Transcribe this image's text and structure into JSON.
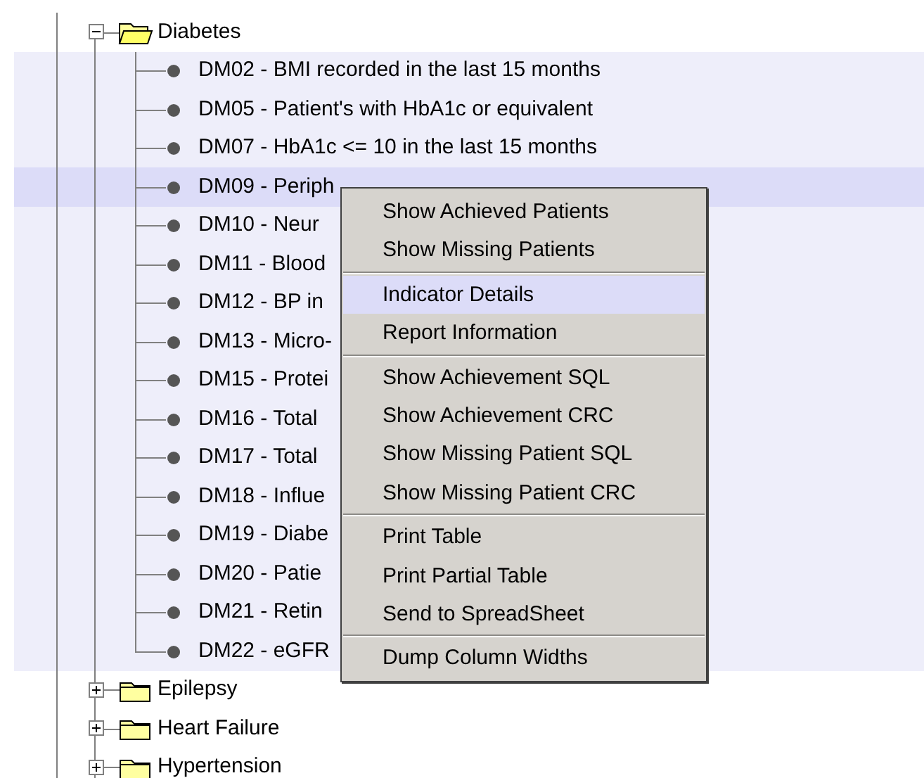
{
  "tree": [
    {
      "label": "Diabetes",
      "expanded": true,
      "children": [
        {
          "label": "DM02 - BMI recorded in the last 15 months",
          "selected": false
        },
        {
          "label": "DM05 - Patient's with HbA1c or equivalent",
          "selected": false
        },
        {
          "label": "DM07 - HbA1c <= 10 in the last 15 months",
          "selected": false
        },
        {
          "label": "DM09 - Periph",
          "selected": true
        },
        {
          "label": "DM10 - Neur",
          "selected": false
        },
        {
          "label": "DM11 - Blood",
          "selected": false
        },
        {
          "label": "DM12 - BP in",
          "selected": false
        },
        {
          "label": "DM13 - Micro-",
          "selected": false
        },
        {
          "label": "DM15 - Protei",
          "selected": false
        },
        {
          "label": "DM16 - Total",
          "selected": false
        },
        {
          "label": "DM17 - Total",
          "selected": false
        },
        {
          "label": "DM18 - Influe",
          "selected": false
        },
        {
          "label": "DM19 - Diabe",
          "selected": false
        },
        {
          "label": "DM20 - Patie",
          "selected": false
        },
        {
          "label": "DM21 - Retin",
          "selected": false
        },
        {
          "label": "DM22 - eGFR",
          "selected": false
        }
      ]
    },
    {
      "label": "Epilepsy",
      "expanded": false
    },
    {
      "label": "Heart Failure",
      "expanded": false
    },
    {
      "label": "Hypertension",
      "expanded": false
    }
  ],
  "context_menu": {
    "sections": [
      [
        {
          "label": "Show Achieved Patients",
          "selected": false
        },
        {
          "label": "Show Missing Patients",
          "selected": false
        }
      ],
      [
        {
          "label": "Indicator Details",
          "selected": true
        },
        {
          "label": "Report Information",
          "selected": false
        }
      ],
      [
        {
          "label": "Show Achievement SQL",
          "selected": false
        },
        {
          "label": "Show Achievement CRC",
          "selected": false
        },
        {
          "label": "Show Missing Patient SQL",
          "selected": false
        },
        {
          "label": "Show Missing Patient CRC",
          "selected": false
        }
      ],
      [
        {
          "label": "Print Table",
          "selected": false
        },
        {
          "label": "Print Partial Table",
          "selected": false
        },
        {
          "label": "Send to SpreadSheet",
          "selected": false
        }
      ],
      [
        {
          "label": "Dump Column Widths",
          "selected": false
        }
      ]
    ]
  }
}
